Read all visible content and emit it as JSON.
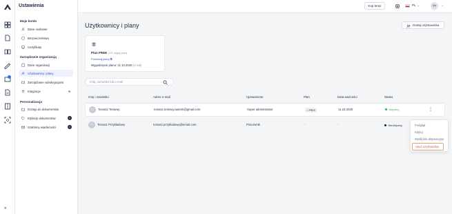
{
  "header": {
    "title": "Ustawienia",
    "buy_label": "Kup teraz",
    "lang": "PL",
    "avatar": "TT"
  },
  "sidebar": {
    "sections": [
      {
        "title": "Moje konto",
        "items": [
          {
            "label": "Dane osobowe",
            "icon": "user-icon"
          },
          {
            "label": "Bezpieczeństwo",
            "icon": "shield-icon"
          },
          {
            "label": "Certyfikaty",
            "icon": "certificate-icon"
          }
        ]
      },
      {
        "title": "Zarządzanie organizacją",
        "items": [
          {
            "label": "Dane organizacji",
            "icon": "building-icon"
          },
          {
            "label": "Użytkownicy i plany",
            "icon": "users-icon",
            "active": true
          },
          {
            "label": "Zarządzanie subskrypcjami",
            "icon": "card-icon"
          },
          {
            "label": "Integracje",
            "icon": "plug-icon"
          }
        ]
      },
      {
        "title": "Personalizacja",
        "items": [
          {
            "label": "Dostęp do dokumentów",
            "icon": "folder-icon"
          },
          {
            "label": "Etykiety dokumentów",
            "icon": "tag-icon",
            "count": "0"
          },
          {
            "label": "Szablony wiadomości",
            "icon": "mail-icon",
            "count": "0"
          }
        ]
      }
    ],
    "rail_badge": "1"
  },
  "main": {
    "title": "Użytkownicy i plany",
    "add_user_label": "Dodaj użytkownika",
    "plan": {
      "name": "Plan FREE",
      "note": "(1/1 zajęty plan)",
      "compare_label": "Porównaj plany",
      "expiry_label": "Wygaśnięcie planu: 11.10.2026",
      "expiry_note": "(1 rok)"
    },
    "search": {
      "placeholder": "Imię, nazwisko lub e-mail"
    },
    "table": {
      "headers": [
        "Imię i nazwisko",
        "Adres e-mail",
        "Uprawnienie",
        "Plan",
        "Data ważności",
        "Status"
      ],
      "rows": [
        {
          "initials": "TT",
          "name": "Tomasz Testowy",
          "email": "tomasz.testowy.autenti@gmail.com",
          "role": "Super administrator",
          "plan": "FREE",
          "expiry": "11.10.2025",
          "status": "Aktywny",
          "status_color": "#2fb36b"
        },
        {
          "initials": "TP",
          "name": "Tomasz Przykładowy",
          "email": "tomasz.przykladowy@email.com",
          "role": "Pracownik",
          "plan": "-",
          "expiry": "-",
          "status": "Nieaktywny",
          "status_color": "#1f2a44"
        }
      ]
    },
    "context_menu": {
      "items": [
        "Podgląd",
        "Edytuj",
        "Wyślij link aktywacyjny",
        "Usuń użytkownika"
      ]
    }
  },
  "colors": {
    "accent": "#2d55c8",
    "active_bg": "#eef2fc",
    "danger": "#d9534f",
    "highlight": "#e3a56b"
  }
}
